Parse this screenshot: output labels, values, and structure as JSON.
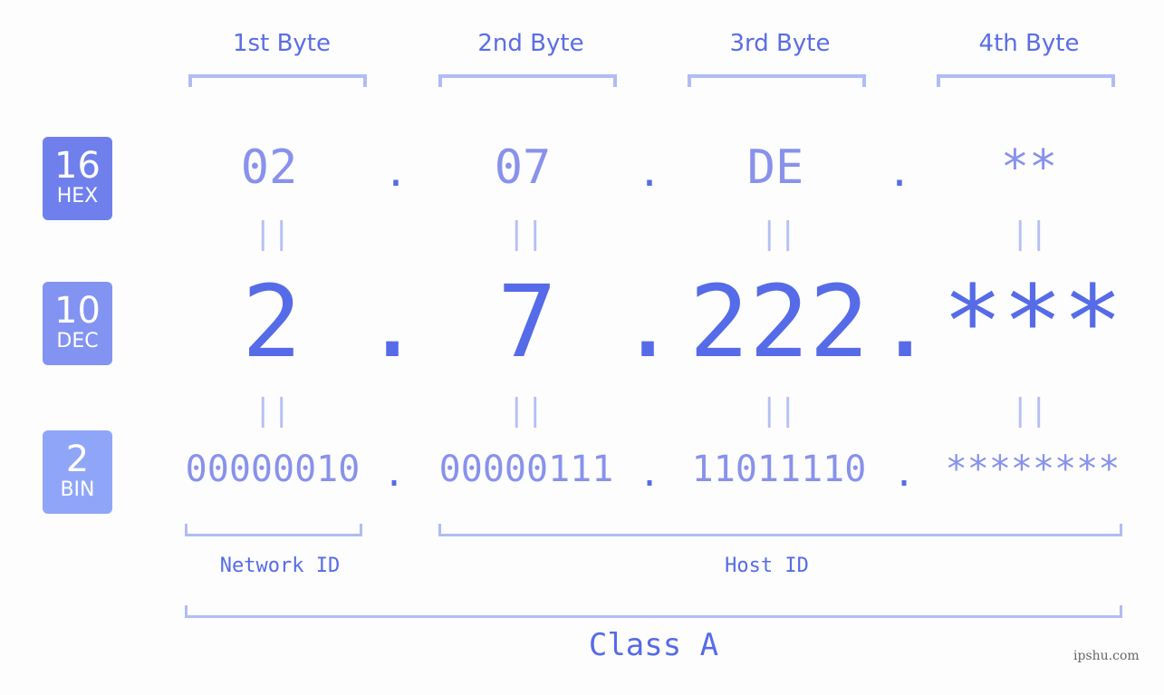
{
  "bytes": {
    "headers": [
      "1st Byte",
      "2nd Byte",
      "3rd Byte",
      "4th Byte"
    ],
    "hex": [
      "02",
      "07",
      "DE",
      "**"
    ],
    "dec": [
      "2",
      "7",
      "222",
      "***"
    ],
    "bin": [
      "00000010",
      "00000111",
      "11011110",
      "********"
    ]
  },
  "separator": ".",
  "equals": "||",
  "badges": [
    {
      "num": "16",
      "label": "HEX",
      "color": "#6f80ec"
    },
    {
      "num": "10",
      "label": "DEC",
      "color": "#8393f1"
    },
    {
      "num": "2",
      "label": "BIN",
      "color": "#8fa6f8"
    }
  ],
  "network_label": "Network ID",
  "host_label": "Host ID",
  "class_label": "Class A",
  "watermark": "ipshu.com",
  "colors": {
    "primary": "#566be8",
    "light": "#8892ec",
    "bracket": "#b1bcf6"
  }
}
